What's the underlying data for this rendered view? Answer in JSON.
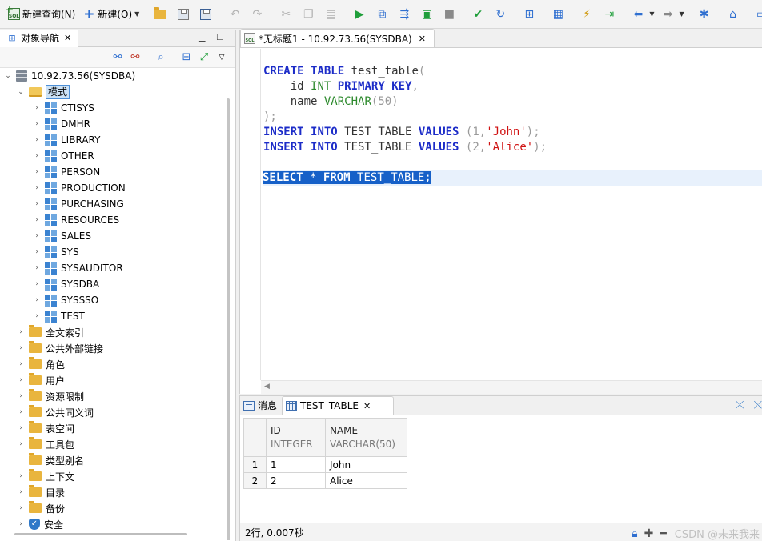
{
  "toolbar": {
    "new_query": "新建查询(N)",
    "new": "新建(O)",
    "icons": [
      "new-sql-icon",
      "plus-icon",
      "open-folder-icon",
      "save-icon",
      "save-all-icon",
      "undo-icon",
      "redo-icon",
      "cut-icon",
      "copy-icon",
      "paste-icon",
      "run-icon",
      "run-selection-icon",
      "run-script-icon",
      "run-file-icon",
      "stop-icon",
      "commit-icon",
      "rollback-icon",
      "explain-icon",
      "schedule-icon",
      "debug-icon",
      "step-icon",
      "back-icon",
      "forward-icon",
      "bug-icon",
      "home-icon",
      "layout-icon"
    ]
  },
  "navigator": {
    "tab_label": "对象导航",
    "connection": "10.92.73.56(SYSDBA)",
    "schema_folder": "模式",
    "schemas": [
      "CTISYS",
      "DMHR",
      "LIBRARY",
      "OTHER",
      "PERSON",
      "PRODUCTION",
      "PURCHASING",
      "RESOURCES",
      "SALES",
      "SYS",
      "SYSAUDITOR",
      "SYSDBA",
      "SYSSSO",
      "TEST"
    ],
    "folders": [
      "全文索引",
      "公共外部链接",
      "角色",
      "用户",
      "资源限制",
      "公共同义词",
      "表空间",
      "工具包",
      "类型别名",
      "上下文",
      "目录",
      "备份",
      "安全"
    ]
  },
  "editor": {
    "tab_label": "*无标题1 - 10.92.73.56(SYSDBA)",
    "lines": [
      "CREATE TABLE test_table(",
      "    id INT PRIMARY KEY,",
      "    name VARCHAR(50)",
      ");",
      "INSERT INTO TEST_TABLE VALUES (1,'John');",
      "INSERT INTO TEST_TABLE VALUES (2,'Alice');",
      "",
      "SELECT * FROM TEST_TABLE;"
    ],
    "tokens": {
      "create": "CREATE",
      "table": "TABLE",
      "test_table": "test_table",
      "open_paren": "(",
      "id": "id",
      "int": "INT",
      "primary": "PRIMARY",
      "key": "KEY",
      "comma": ",",
      "name": "name",
      "varchar": "VARCHAR",
      "fifty": "(50)",
      "close": ");",
      "insert": "INSERT",
      "into": "INTO",
      "TEST_TABLE": "TEST_TABLE",
      "values": "VALUES",
      "v1": "(1,",
      "john": "'John'",
      "v2": "(2,",
      "alice": "'Alice'",
      "end": ");",
      "select": "SELECT",
      "star": "*",
      "from": "FROM",
      "semi": ";"
    }
  },
  "results": {
    "tabs": [
      "消息",
      "TEST_TABLE"
    ],
    "columns": [
      {
        "name": "ID",
        "type": "INTEGER"
      },
      {
        "name": "NAME",
        "type": "VARCHAR(50)"
      }
    ],
    "rows": [
      {
        "row_num": "1",
        "id": "1",
        "name": "John"
      },
      {
        "row_num": "2",
        "id": "2",
        "name": "Alice"
      }
    ],
    "status": "2行, 0.007秒",
    "watermark": "CSDN @未来我来"
  },
  "colors": {
    "keyword": "#1c2cc8",
    "type": "#2d8a2d",
    "string": "#d01212",
    "selection": "#1660c8"
  }
}
